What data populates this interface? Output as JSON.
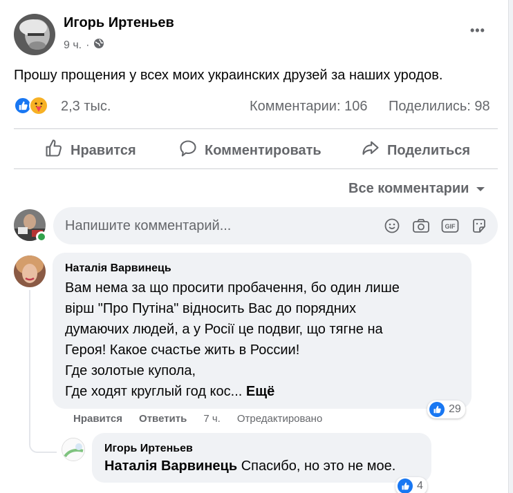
{
  "post": {
    "author": "Игорь Иртеньев",
    "time": "9 ч.",
    "more_label": "•••",
    "text": "Прошу прощения у всех моих украинских друзей за наших уродов.",
    "reactions_count": "2,3 тыс.",
    "comments_count": "Комментарии: 106",
    "shares_count": "Поделились: 98"
  },
  "actions": {
    "like": "Нравится",
    "comment": "Комментировать",
    "share": "Поделиться"
  },
  "filter": {
    "label": "Все комментарии"
  },
  "composer": {
    "placeholder": "Напишите комментарий..."
  },
  "comments": [
    {
      "author": "Наталія Варвинець",
      "lines": [
        "Вам нема за що просити пробачення, бо один лише",
        "вірш \"Про Путіна\" відносить Вас до порядних",
        "думаючих людей, а у Росії це подвиг, що тягне на",
        "Героя! Какое счастье жить в России!",
        "Где золотые купола,",
        "Где ходят круглый год кос..."
      ],
      "more": "Ещё",
      "like": "Нравится",
      "reply": "Ответить",
      "time": "7 ч.",
      "edited": "Отредактировано",
      "reactions": "29"
    }
  ],
  "reply": {
    "author": "Игорь Иртеньев",
    "mention": "Наталія Варвинець",
    "text": " Спасибо, но это не мое.",
    "reactions": "4"
  }
}
